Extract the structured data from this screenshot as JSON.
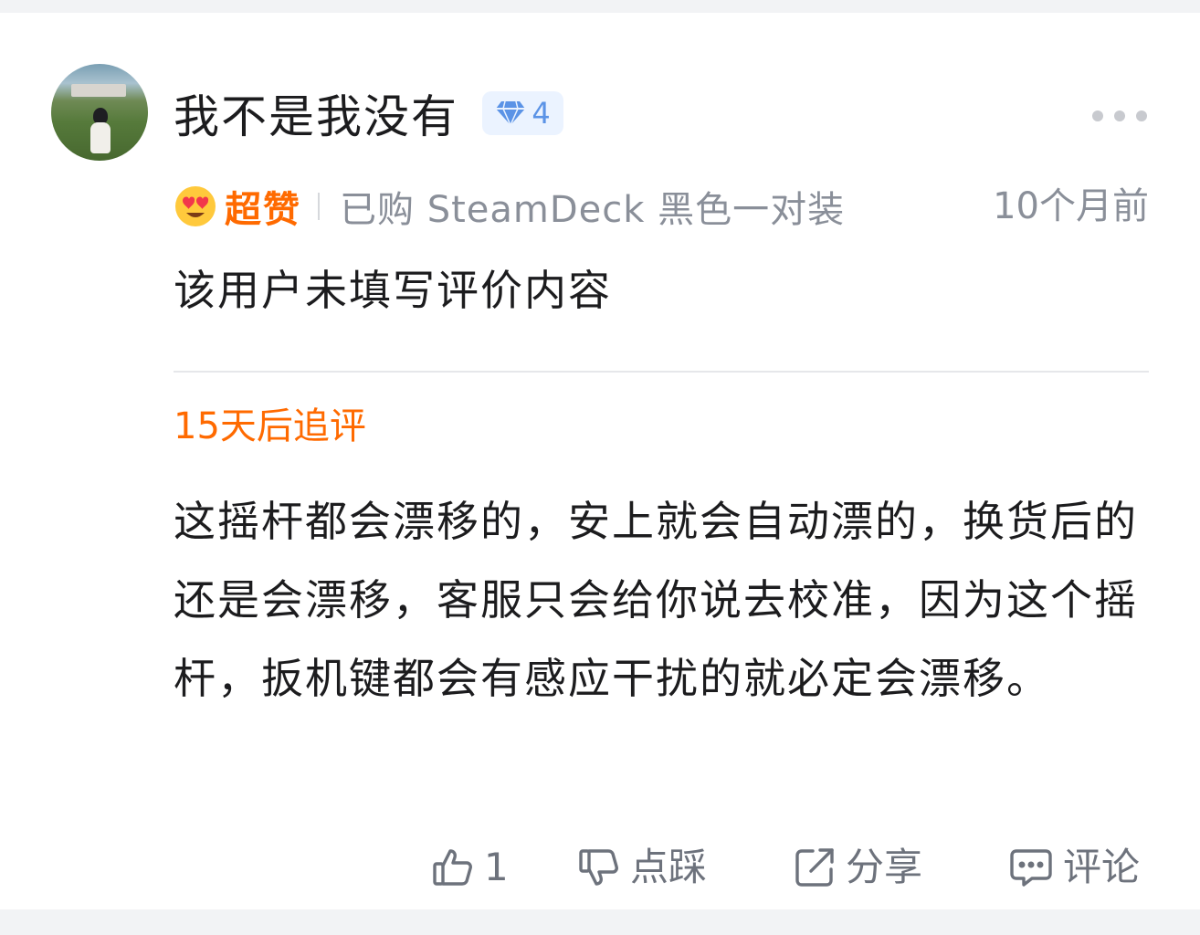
{
  "review": {
    "username": "我不是我没有",
    "level": "4",
    "rating_label": "超赞",
    "purchased_info": "已购 SteamDeck 黑色一对装",
    "time": "10个月前",
    "content": "该用户未填写评价内容"
  },
  "followup": {
    "title": "15天后追评",
    "content": "这摇杆都会漂移的，安上就会自动漂的，换货后的还是会漂移，客服只会给你说去校准，因为这个摇杆，扳机键都会有感应干扰的就必定会漂移。"
  },
  "actions": {
    "like_count": "1",
    "dislike_label": "点踩",
    "share_label": "分享",
    "comment_label": "评论"
  },
  "colors": {
    "accent_orange": "#ff6a00",
    "badge_blue": "#5b93e6",
    "badge_bg": "#ebf3ff",
    "secondary_text": "#8a8f99",
    "action_gray": "#6d727c"
  },
  "icons": {
    "level": "diamond-icon",
    "rating": "heart-eyes-emoji-icon",
    "more": "more-dots-icon",
    "like": "thumbs-up-icon",
    "dislike": "thumbs-down-icon",
    "share": "share-icon",
    "comment": "comment-icon"
  }
}
